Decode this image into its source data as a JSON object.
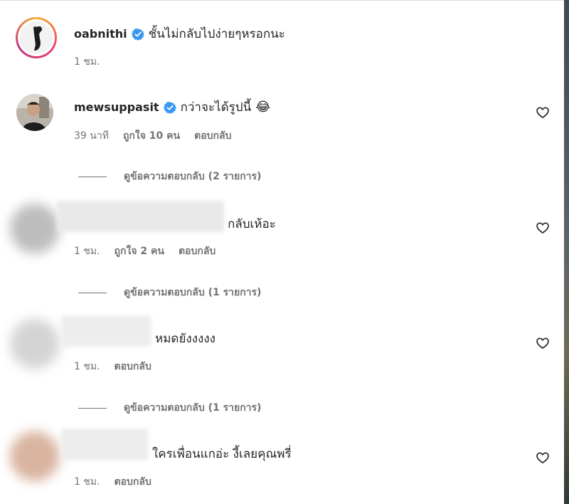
{
  "comments": [
    {
      "username": "oabnithi",
      "verified": true,
      "text": "ชั้นไม่กลับไปง่ายๆหรอกนะ",
      "time": "1 ชม."
    },
    {
      "username": "mewsuppasit",
      "verified": true,
      "text": "กว่าจะได้รูปนี้",
      "emoji": "😂",
      "time": "39 นาที",
      "likes": "ถูกใจ 10 คน",
      "reply": "ตอบกลับ",
      "view_replies": "ดูข้อความตอบกลับ (2 รายการ)"
    },
    {
      "text": "กลับเห้อะ",
      "time": "1 ชม.",
      "likes": "ถูกใจ 2 คน",
      "reply": "ตอบกลับ",
      "view_replies": "ดูข้อความตอบกลับ (1 รายการ)"
    },
    {
      "text": "หมดยังงงงง",
      "time": "1 ชม.",
      "reply": "ตอบกลับ",
      "view_replies": "ดูข้อความตอบกลับ (1 รายการ)"
    },
    {
      "text": "ใครเพื่อนแกอ่ะ งี้เลยคุณพรี่",
      "time": "1 ชม.",
      "reply": "ตอบกลับ"
    }
  ],
  "colors": {
    "verified": "#3897f0",
    "muted": "#737373",
    "text": "#262626"
  },
  "icons": [
    "verified-badge-icon",
    "heart-icon"
  ]
}
